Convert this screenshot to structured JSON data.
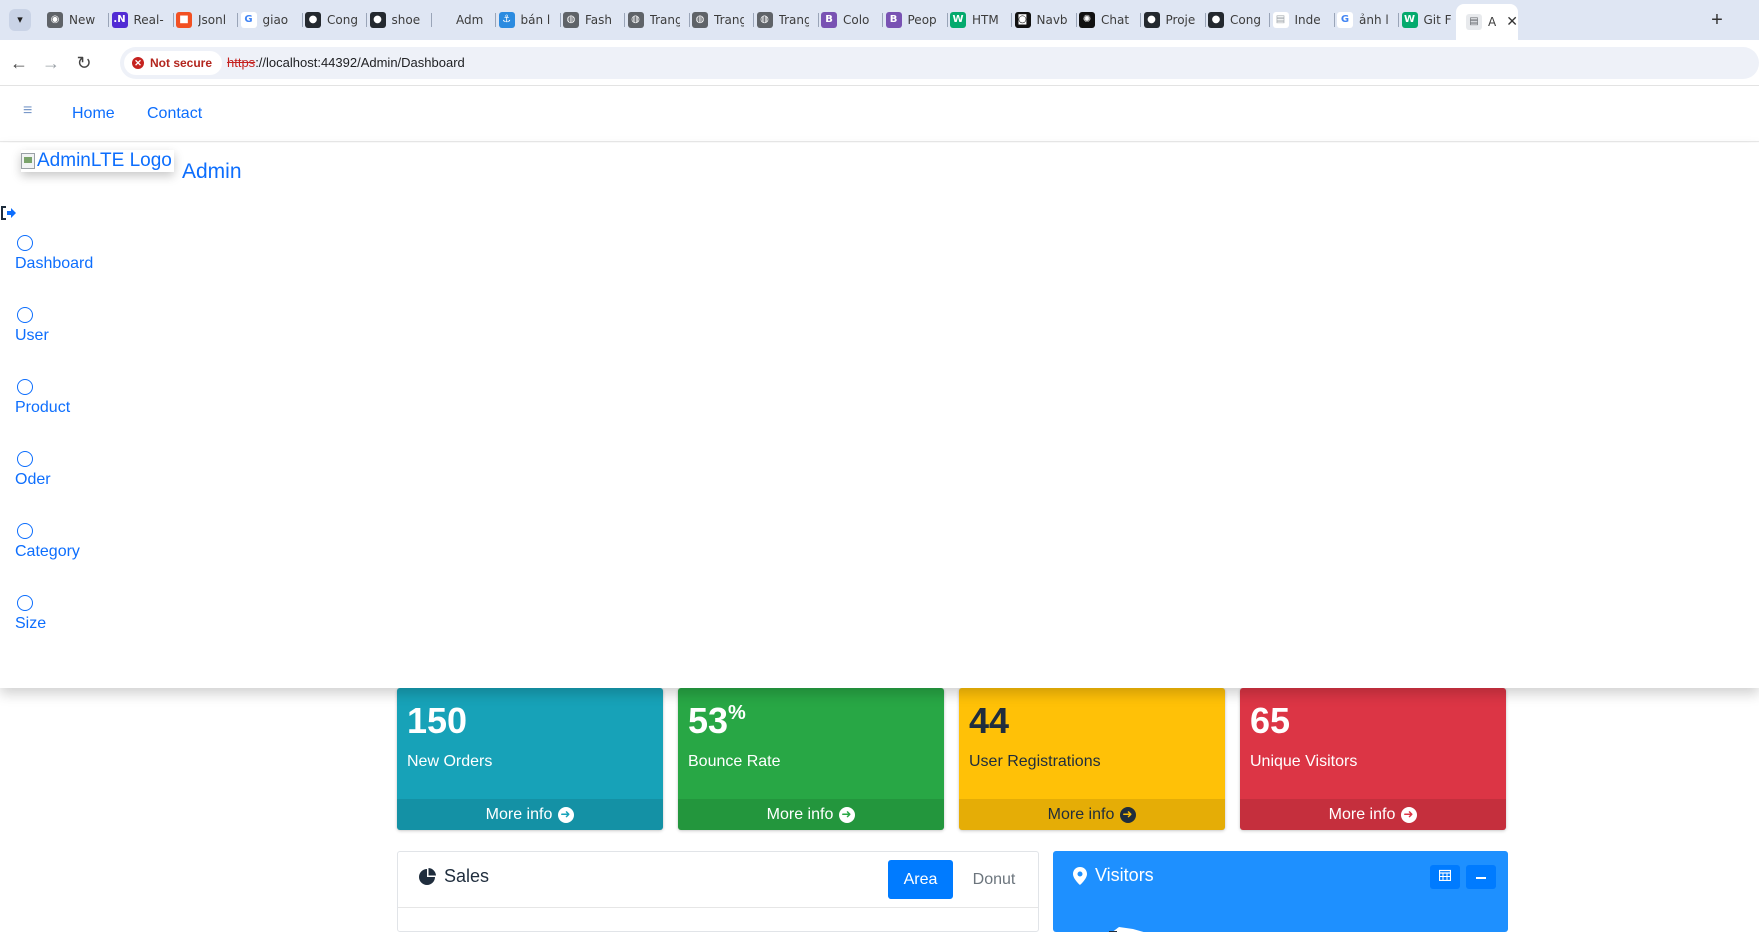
{
  "browser": {
    "tabs": [
      {
        "title": "New",
        "favicon": "chrome-icon",
        "color": "#5f6368"
      },
      {
        "title": "Real-",
        "favicon": "dotnet-icon",
        "color": "#512bd4"
      },
      {
        "title": "Jsonl",
        "favicon": "microsoft-icon",
        "color": "#f25022"
      },
      {
        "title": "giao",
        "favicon": "google-icon",
        "color": "#4285f4"
      },
      {
        "title": "Cong",
        "favicon": "github-icon",
        "color": "#24292f"
      },
      {
        "title": "shoe",
        "favicon": "github-icon",
        "color": "#24292f"
      },
      {
        "title": "Adm",
        "favicon": "blank-icon",
        "color": "#dfe6f3"
      },
      {
        "title": "bán l",
        "favicon": "site-icon",
        "color": "#2b8be0"
      },
      {
        "title": "Fash",
        "favicon": "globe-icon",
        "color": "#5f6368"
      },
      {
        "title": "Trang",
        "favicon": "globe-icon",
        "color": "#5f6368"
      },
      {
        "title": "Trang",
        "favicon": "globe-icon",
        "color": "#5f6368"
      },
      {
        "title": "Trang",
        "favicon": "globe-icon",
        "color": "#5f6368"
      },
      {
        "title": "Colo",
        "favicon": "bootstrap-icon",
        "color": "#7952b3"
      },
      {
        "title": "Peop",
        "favicon": "bootstrap-icon",
        "color": "#7952b3"
      },
      {
        "title": "HTM",
        "favicon": "w3schools-icon",
        "color": "#04aa6d"
      },
      {
        "title": "Navb",
        "favicon": "bot-icon",
        "color": "#111111"
      },
      {
        "title": "Chat",
        "favicon": "openai-icon",
        "color": "#111111"
      },
      {
        "title": "Proje",
        "favicon": "github-icon",
        "color": "#24292f"
      },
      {
        "title": "Cong",
        "favicon": "github-icon",
        "color": "#24292f"
      },
      {
        "title": "Inde",
        "favicon": "doc-icon",
        "color": "#9aa0a6"
      },
      {
        "title": "ảnh l",
        "favicon": "google-icon",
        "color": "#4285f4"
      },
      {
        "title": "Git F",
        "favicon": "w3schools-icon",
        "color": "#04aa6d"
      }
    ],
    "active_tab": {
      "title": "A",
      "favicon": "doc-icon"
    },
    "security_label": "Not secure",
    "url_scheme": "https",
    "url_rest": "://localhost:44392/Admin/Dashboard"
  },
  "topnav": {
    "links": [
      "Home",
      "Contact"
    ]
  },
  "sidebar": {
    "logo_alt": "AdminLTE Logo",
    "brand": "Admin",
    "items": [
      "Dashboard",
      "User",
      "Product",
      "Oder",
      "Category",
      "Size"
    ]
  },
  "stats": [
    {
      "value": "150",
      "suffix": "",
      "label": "New Orders",
      "footer": "More info",
      "color": "#17a2b8"
    },
    {
      "value": "53",
      "suffix": "%",
      "label": "Bounce Rate",
      "footer": "More info",
      "color": "#28a745"
    },
    {
      "value": "44",
      "suffix": "",
      "label": "User Registrations",
      "footer": "More info",
      "color": "#ffc107"
    },
    {
      "value": "65",
      "suffix": "",
      "label": "Unique Visitors",
      "footer": "More info",
      "color": "#dc3545"
    }
  ],
  "sales_card": {
    "title": "Sales",
    "tabs": [
      "Area",
      "Donut"
    ],
    "active_tab": "Area"
  },
  "visitors_card": {
    "title": "Visitors",
    "color": "#1e90ff"
  }
}
